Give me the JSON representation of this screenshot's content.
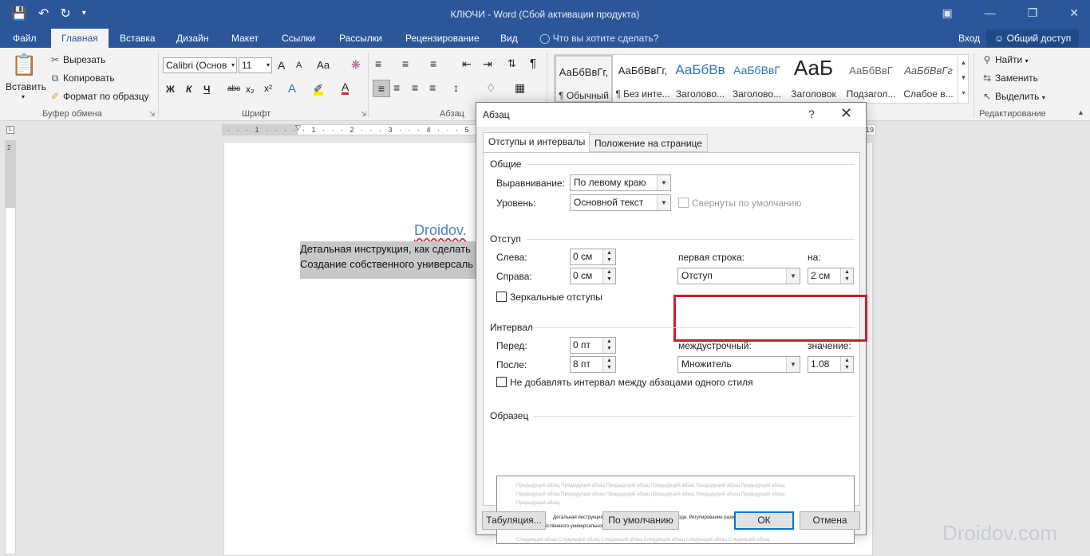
{
  "titlebar": {
    "title": "КЛЮЧИ - Word (Сбой активации продукта)",
    "qat_icons": [
      "save-icon",
      "undo-icon",
      "redo-icon",
      "customize-icon"
    ],
    "win_icons": [
      "ribbon-display-icon",
      "minimize-icon",
      "restore-icon",
      "close-icon"
    ]
  },
  "tabs": {
    "items": [
      "Файл",
      "Главная",
      "Вставка",
      "Дизайн",
      "Макет",
      "Ссылки",
      "Рассылки",
      "Рецензирование",
      "Вид"
    ],
    "active": "Главная",
    "tell_me": "Что вы хотите сделать?",
    "login": "Вход",
    "share": "Общий доступ"
  },
  "ribbon": {
    "clipboard": {
      "paste": "Вставить",
      "cut": "Вырезать",
      "copy": "Копировать",
      "format_painter": "Формат по образцу",
      "label": "Буфер обмена"
    },
    "font": {
      "name": "Calibri (Основ",
      "size": "11",
      "label": "Шрифт",
      "bold": "Ж",
      "italic": "К",
      "underline": "Ч",
      "strike": "abc",
      "case": "Аа",
      "grow": "A",
      "shrink": "A"
    },
    "paragraph": {
      "label": "Абзац"
    },
    "styles": {
      "items": [
        {
          "sample": "АаБбВвГг,",
          "name": "¶ Обычный"
        },
        {
          "sample": "АаБбВвГг,",
          "name": "¶ Без инте..."
        },
        {
          "sample": "АаБбВв",
          "name": "Заголово..."
        },
        {
          "sample": "АаБбВвГ",
          "name": "Заголово..."
        },
        {
          "sample": "АаБ",
          "name": "Заголовок"
        },
        {
          "sample": "АаБбВвГ",
          "name": "Подзагол..."
        },
        {
          "sample": "АаБбВвГг",
          "name": "Слабое в..."
        }
      ]
    },
    "editing": {
      "find": "Найти",
      "replace": "Заменить",
      "select": "Выделить",
      "label": "Редактирование"
    }
  },
  "ruler": {
    "left_label": "2",
    "right_label": "19"
  },
  "document": {
    "title": "Droidov.",
    "line1": "Детальная инструкция, как сделать",
    "line2": "Создание собственного универсаль"
  },
  "watermark": "Droidov.com",
  "dialog": {
    "title": "Абзац",
    "help": "?",
    "tabs": [
      "Отступы и интервалы",
      "Положение на странице"
    ],
    "general": {
      "heading": "Общие",
      "alignment_label": "Выравнивание:",
      "alignment_value": "По левому краю",
      "level_label": "Уровень:",
      "level_value": "Основной текст",
      "collapsed_label": "Свернуты по умолчанию"
    },
    "indent": {
      "heading": "Отступ",
      "left_label": "Слева:",
      "left_value": "0 см",
      "right_label": "Справа:",
      "right_value": "0 см",
      "first_line_label": "первая строка:",
      "first_line_value": "Отступ",
      "by_label": "на:",
      "by_value": "2 см",
      "mirror_label": "Зеркальные отступы"
    },
    "spacing": {
      "heading": "Интервал",
      "before_label": "Перед:",
      "before_value": "0 пт",
      "after_label": "После:",
      "after_value": "8 пт",
      "line_label": "междустрочный:",
      "line_value": "Множитель",
      "at_label": "значение:",
      "at_value": "1.08",
      "no_space_label": "Не добавлять интервал между абзацами одного стиля"
    },
    "preview": {
      "heading": "Образец",
      "prev_text": "Предыдущий абзац Предыдущий абзац Предыдущий абзац Предыдущий абзац Предыдущий абзац Предыдущий абзац",
      "prev_text_short": "Предыдущий абзац",
      "main_line1": "Детальная инструкция, как сделать красную строку в Ворде. Регулирование размеров отступа.",
      "main_line2": "Создание собственного универсального стиля.",
      "next_text": "Следующий абзац Следующий абзац Следующий абзац Следующий абзац Следующий абзац Следующий абзац"
    },
    "buttons": {
      "tabs": "Табуляция...",
      "default": "По умолчанию",
      "ok": "ОК",
      "cancel": "Отмена"
    }
  },
  "colors": {
    "title_bar": "#2b579a",
    "highlight_box": "#c8202e",
    "doc_title": "#4f81bd"
  }
}
